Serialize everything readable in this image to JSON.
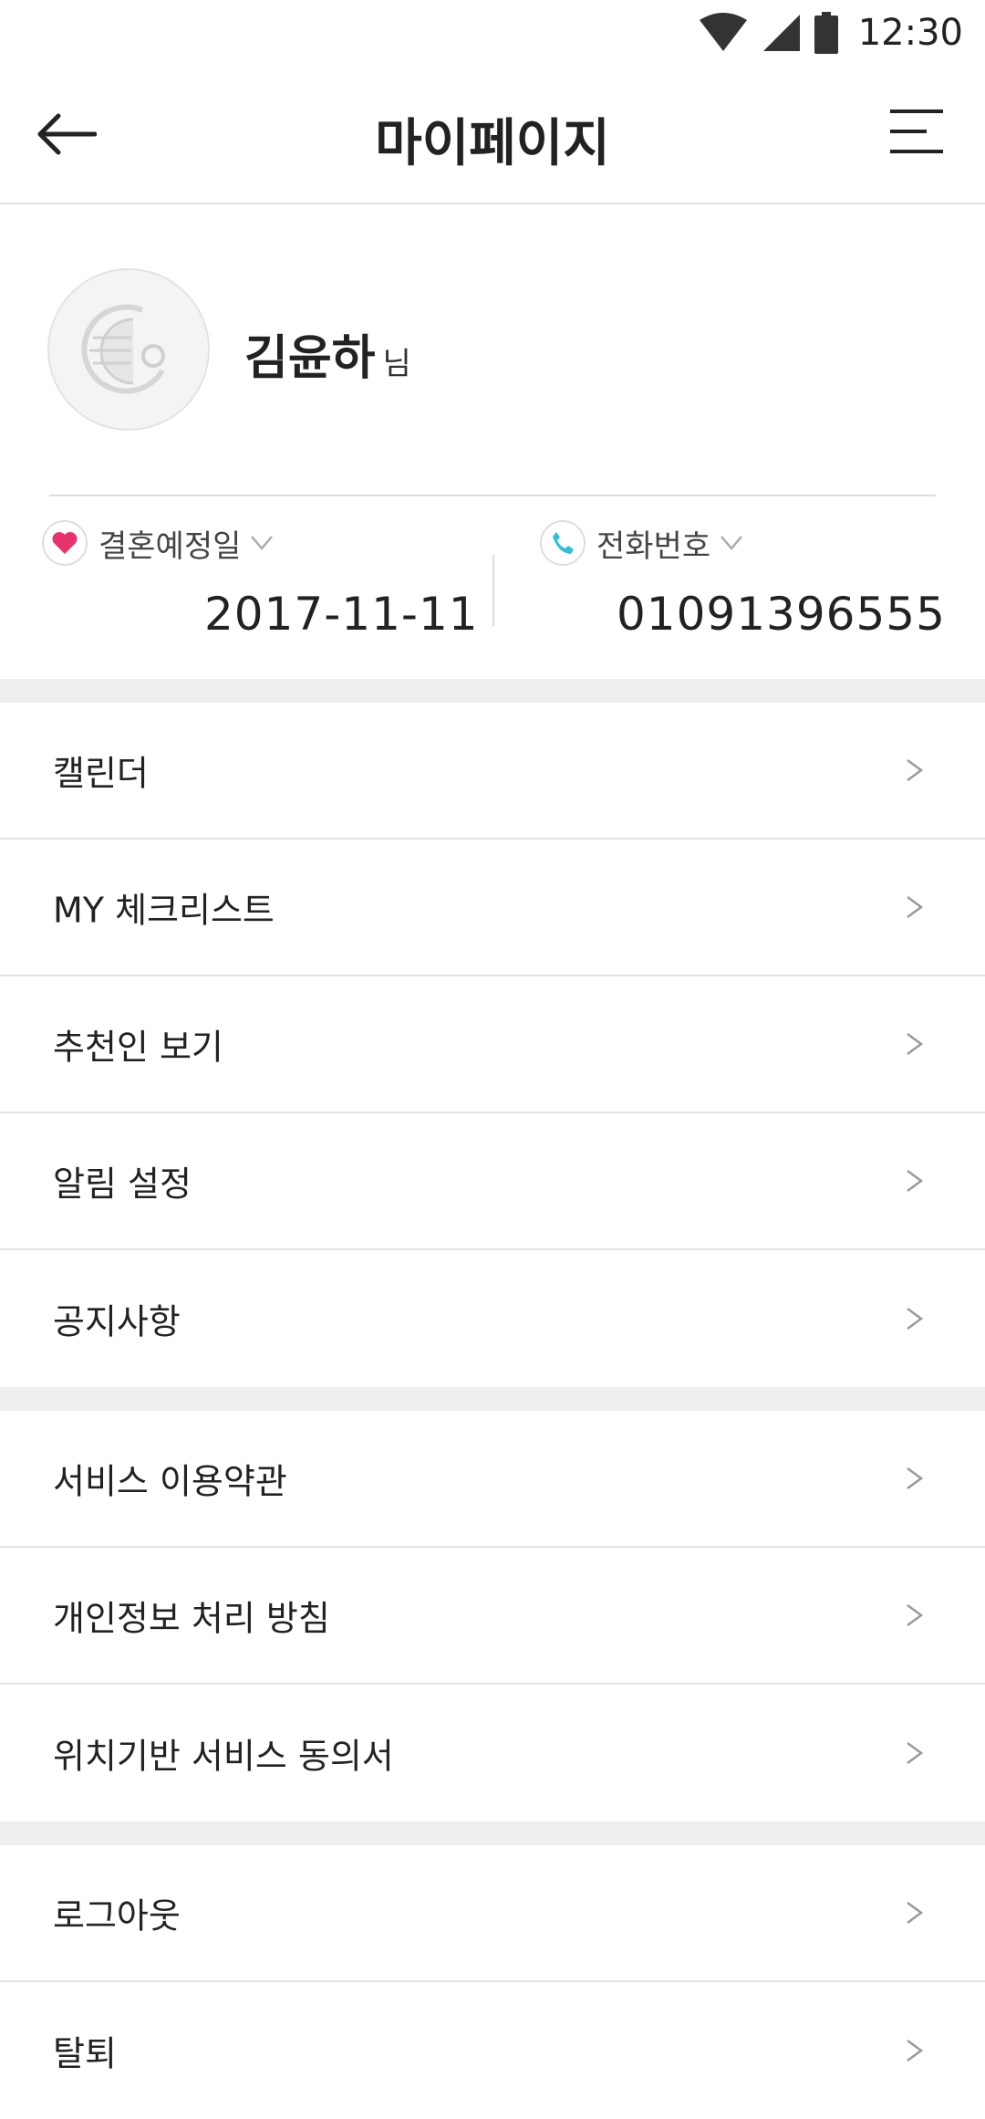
{
  "status_bar": {
    "time": "12:30"
  },
  "header": {
    "title": "마이페이지"
  },
  "profile": {
    "name": "김윤하",
    "name_suffix": "님"
  },
  "info": {
    "wedding": {
      "label": "결혼예정일",
      "value": "2017-11-11",
      "icon": "heart-icon",
      "icon_color": "#e8336d"
    },
    "phone": {
      "label": "전화번호",
      "value": "01091396555",
      "icon": "phone-icon",
      "icon_color": "#2cc1d6"
    }
  },
  "menu_group_1": [
    {
      "label": "캘린더"
    },
    {
      "label": "MY 체크리스트"
    },
    {
      "label": "추천인 보기"
    },
    {
      "label": "알림 설정"
    },
    {
      "label": "공지사항"
    }
  ],
  "menu_group_2": [
    {
      "label": "서비스 이용약관"
    },
    {
      "label": "개인정보 처리 방침"
    },
    {
      "label": "위치기반 서비스 동의서"
    }
  ],
  "menu_group_3": [
    {
      "label": "로그아웃"
    },
    {
      "label": "탈퇴"
    }
  ]
}
